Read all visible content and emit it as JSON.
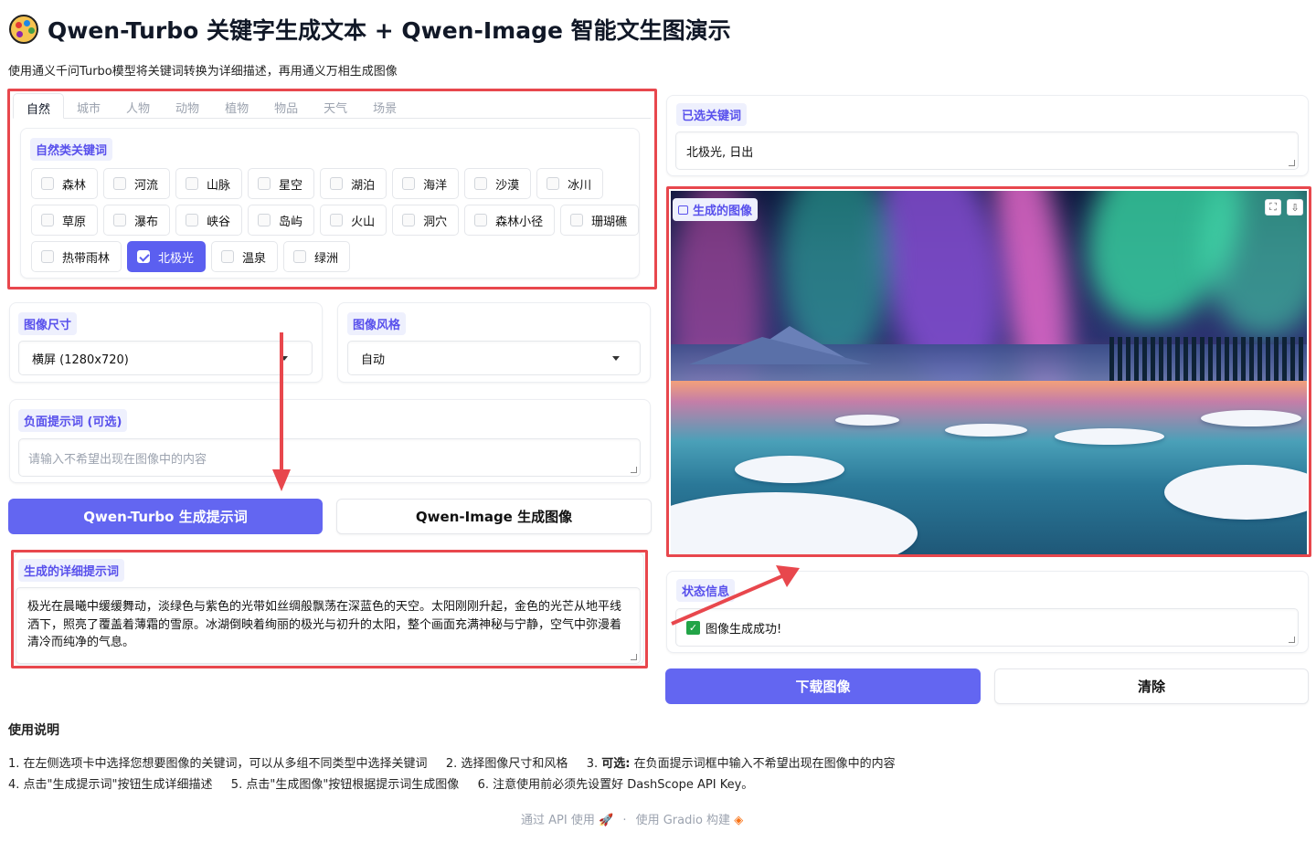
{
  "header": {
    "title": "Qwen-Turbo 关键字生成文本 + Qwen-Image 智能文生图演示",
    "subtitle": "使用通义千问Turbo模型将关键词转换为详细描述，再用通义万相生成图像"
  },
  "tabs": [
    "自然",
    "城市",
    "人物",
    "动物",
    "植物",
    "物品",
    "天气",
    "场景"
  ],
  "keywords_group": {
    "label": "自然类关键词",
    "items": [
      {
        "label": "森林",
        "checked": false
      },
      {
        "label": "河流",
        "checked": false
      },
      {
        "label": "山脉",
        "checked": false
      },
      {
        "label": "星空",
        "checked": false
      },
      {
        "label": "湖泊",
        "checked": false
      },
      {
        "label": "海洋",
        "checked": false
      },
      {
        "label": "沙漠",
        "checked": false
      },
      {
        "label": "冰川",
        "checked": false
      },
      {
        "label": "草原",
        "checked": false
      },
      {
        "label": "瀑布",
        "checked": false
      },
      {
        "label": "峡谷",
        "checked": false
      },
      {
        "label": "岛屿",
        "checked": false
      },
      {
        "label": "火山",
        "checked": false
      },
      {
        "label": "洞穴",
        "checked": false
      },
      {
        "label": "森林小径",
        "checked": false
      },
      {
        "label": "珊瑚礁",
        "checked": false
      },
      {
        "label": "热带雨林",
        "checked": false
      },
      {
        "label": "北极光",
        "checked": true
      },
      {
        "label": "温泉",
        "checked": false
      },
      {
        "label": "绿洲",
        "checked": false
      }
    ]
  },
  "image_size": {
    "label": "图像尺寸",
    "value": "横屏 (1280x720)"
  },
  "image_style": {
    "label": "图像风格",
    "value": "自动"
  },
  "negative_prompt": {
    "label": "负面提示词 (可选)",
    "placeholder": "请输入不希望出现在图像中的内容"
  },
  "buttons": {
    "gen_prompt": "Qwen-Turbo 生成提示词",
    "gen_image": "Qwen-Image 生成图像",
    "download": "下载图像",
    "clear": "清除"
  },
  "detail_prompt": {
    "label": "生成的详细提示词",
    "value": "极光在晨曦中缓缓舞动，淡绿色与紫色的光带如丝绸般飘荡在深蓝色的天空。太阳刚刚升起，金色的光芒从地平线洒下，照亮了覆盖着薄霜的雪原。冰湖倒映着绚丽的极光与初升的太阳，整个画面充满神秘与宁静，空气中弥漫着清冷而纯净的气息。"
  },
  "selected_keywords": {
    "label": "已选关键词",
    "value": "北极光, 日出"
  },
  "generated_image": {
    "label": "生成的图像"
  },
  "status": {
    "label": "状态信息",
    "value": "图像生成成功!",
    "icon": "check-mark-icon"
  },
  "instructions": {
    "title": "使用说明",
    "line1": [
      {
        "num": "1.",
        "text": "在左侧选项卡中选择您想要图像的关键词，可以从多组不同类型中选择关键词"
      },
      {
        "num": "2.",
        "text": "选择图像尺寸和风格"
      },
      {
        "num": "3.",
        "bold": "可选:",
        "text": "在负面提示词框中输入不希望出现在图像中的内容"
      }
    ],
    "line2": [
      {
        "num": "4.",
        "text": "点击\"生成提示词\"按钮生成详细描述"
      },
      {
        "num": "5.",
        "text": "点击\"生成图像\"按钮根据提示词生成图像"
      },
      {
        "num": "6.",
        "text": "注意使用前必须先设置好 DashScope API Key。"
      }
    ]
  },
  "footer": {
    "api": "通过 API 使用",
    "sep": "·",
    "built": "使用 Gradio 构建"
  }
}
